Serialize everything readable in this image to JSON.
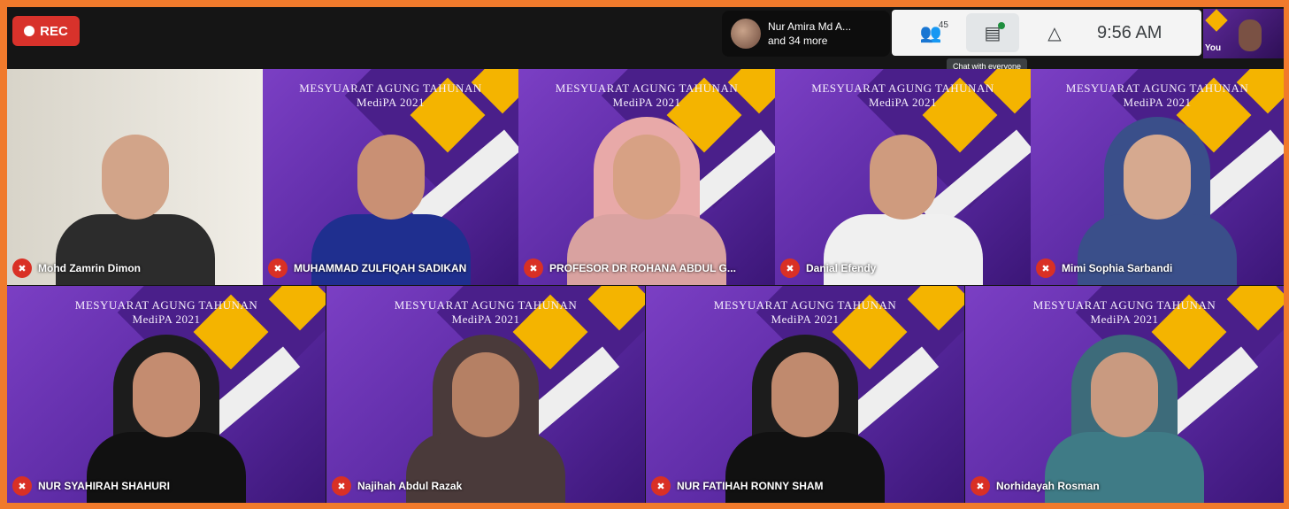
{
  "topbar": {
    "rec_label": "REC",
    "joined_line1": "Nur Amira Md A...",
    "joined_line2": "and 34 more",
    "people_count": "45",
    "chat_tooltip": "Chat with everyone",
    "time": "9:56 AM",
    "self_label": "You"
  },
  "banner": {
    "line1": "MESYUARAT AGUNG TAHUNAN",
    "line2": "MediPA 2021"
  },
  "participants": [
    {
      "name": "Mohd Zamrin Dimon"
    },
    {
      "name": "MUHAMMAD ZULFIQAH SADIKAN"
    },
    {
      "name": "PROFESOR DR ROHANA ABDUL G..."
    },
    {
      "name": "Danial Efendy"
    },
    {
      "name": "Mimi Sophia Sarbandi"
    },
    {
      "name": "NUR SYAHIRAH SHAHURI"
    },
    {
      "name": "Najihah Abdul Razak"
    },
    {
      "name": "NUR FATIHAH RONNY SHAM"
    },
    {
      "name": "Norhidayah Rosman"
    }
  ],
  "colors": {
    "frame": "#f07a2c",
    "tile_purple": "#6a33b4",
    "accent_yellow": "#f4b400",
    "mute_red": "#d93025"
  },
  "icons": [
    "record-dot-icon",
    "people-icon",
    "chat-icon",
    "activities-icon",
    "mic-off-icon"
  ]
}
